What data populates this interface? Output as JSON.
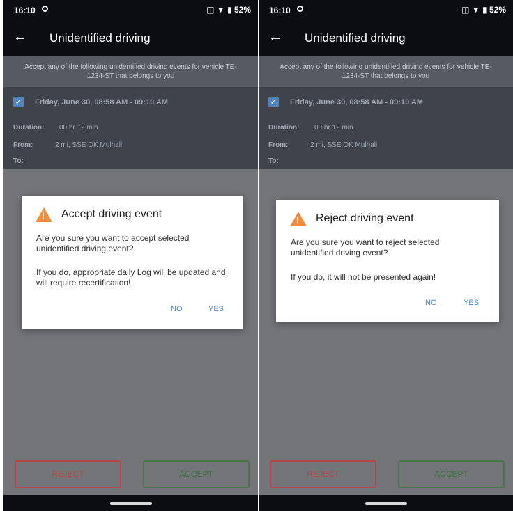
{
  "status_bar": {
    "time": "16:10",
    "battery": "52%"
  },
  "app_bar": {
    "back_icon": "←",
    "title": "Unidentified driving"
  },
  "info_text": "Accept any of the following unidentified driving events for vehicle TE-1234-ST that belongs to you",
  "event": {
    "checked": true,
    "when": "Friday, June 30, 08:58 AM - 09:10 AM",
    "duration_label": "Duration:",
    "duration_value": "00 hr 12 min",
    "from_label": "From:",
    "from_value": "2 mi, SSE OK Mulhall",
    "to_label": "To:"
  },
  "buttons": {
    "reject": "REJECT",
    "accept": "ACCEPT"
  },
  "accept_dialog": {
    "title": "Accept driving event",
    "message1": "Are you sure you want to accept selected unidentified driving event?",
    "message2": "If you do, appropriate daily Log will be updated and will require recertification!",
    "no": "NO",
    "yes": "YES"
  },
  "reject_dialog": {
    "title": "Reject driving event",
    "message1": "Are you sure you want to reject selected unidentified driving event?",
    "message2": "If you do, it will not be presented again!",
    "no": "NO",
    "yes": "YES"
  },
  "colors": {
    "bar": "#0b0d12",
    "info_band": "#565a63",
    "event_card": "#3e434c",
    "scrim": "#737579",
    "reject": "#b4464d",
    "accept": "#477548",
    "dialog_button": "#4c84c4",
    "warning_icon": "#f08c3c"
  },
  "icons": [
    "back-arrow-icon",
    "sync-icon",
    "vibrate-icon",
    "wifi-icon",
    "battery-icon",
    "checkbox-icon",
    "warning-icon"
  ]
}
